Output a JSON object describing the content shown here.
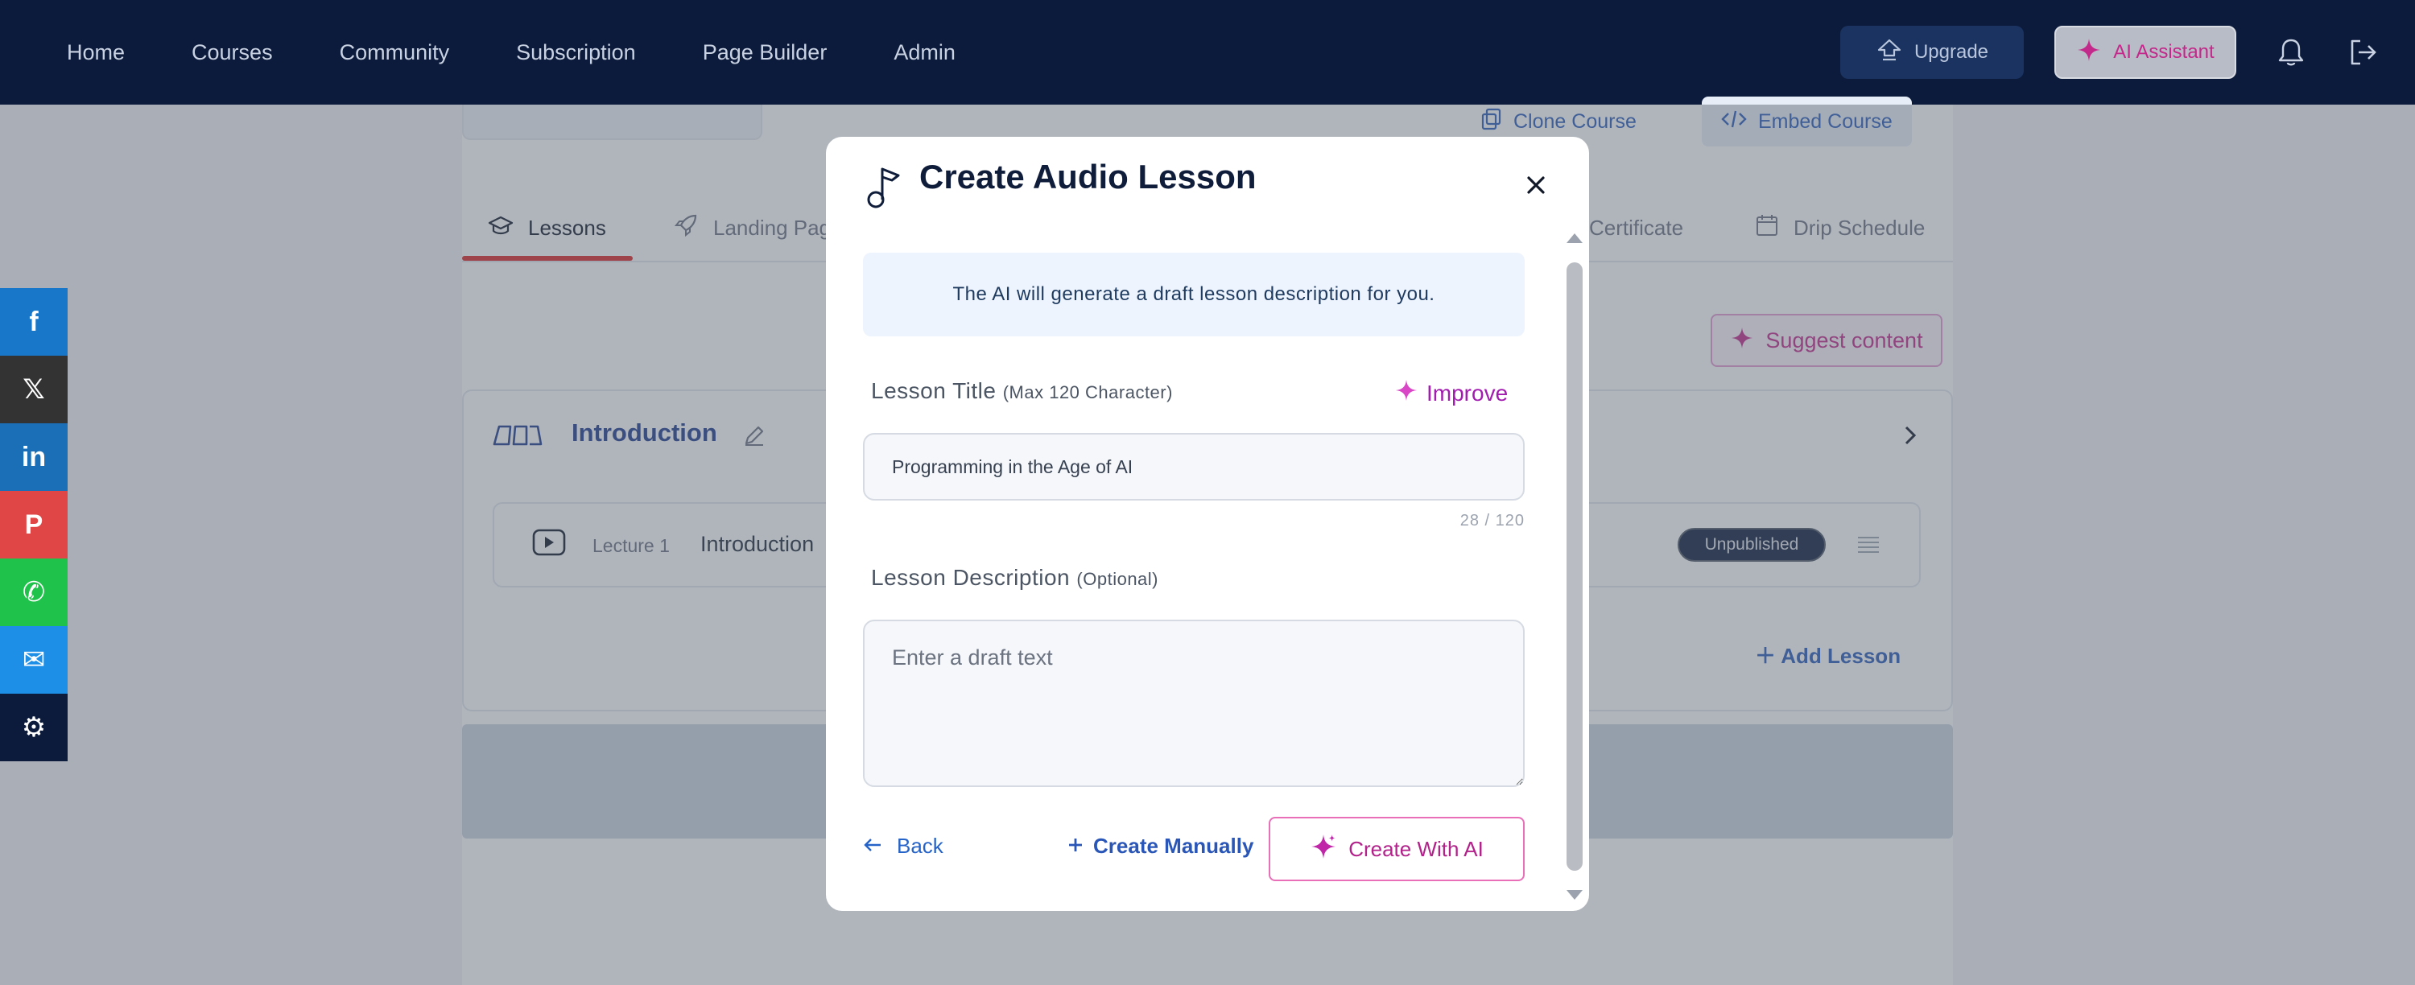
{
  "nav": {
    "links": [
      "Home",
      "Courses",
      "Community",
      "Subscription",
      "Page Builder",
      "Admin"
    ],
    "upgrade_label": "Upgrade",
    "ai_label": "AI Assistant"
  },
  "background": {
    "clone_label": "Clone Course",
    "embed_label": "Embed Course",
    "tabs": [
      "Lessons",
      "Landing Pag",
      "Certificate",
      "Drip Schedule"
    ],
    "suggest_label": "Suggest content",
    "section_title": "Introduction",
    "lecture_label": "Lecture 1",
    "lecture_name": "Introduction",
    "status_badge": "Unpublished",
    "add_lesson_label": "Add Lesson"
  },
  "social": [
    {
      "name": "facebook",
      "glyph": "f",
      "color": "#1877c9"
    },
    {
      "name": "x",
      "glyph": "𝕏",
      "color": "#333333"
    },
    {
      "name": "linkedin",
      "glyph": "in",
      "color": "#1a6fb7"
    },
    {
      "name": "pinterest",
      "glyph": "P",
      "color": "#e04646"
    },
    {
      "name": "whatsapp",
      "glyph": "✆",
      "color": "#1fc24a"
    },
    {
      "name": "email",
      "glyph": "✉",
      "color": "#1e8fe6"
    },
    {
      "name": "settings",
      "glyph": "⚙",
      "color": "#0c1b3b"
    }
  ],
  "modal": {
    "title": "Create Audio Lesson",
    "info": "The AI will generate a draft lesson description for you.",
    "title_label": "Lesson Title",
    "title_hint": "(Max 120 Character)",
    "improve_label": "Improve",
    "title_value": "Programming in the Age of AI",
    "counter": "28 / 120",
    "desc_label": "Lesson Description",
    "desc_hint": "(Optional)",
    "desc_placeholder": "Enter a draft text",
    "back_label": "Back",
    "manual_label": "Create Manually",
    "ai_label": "Create With AI"
  }
}
